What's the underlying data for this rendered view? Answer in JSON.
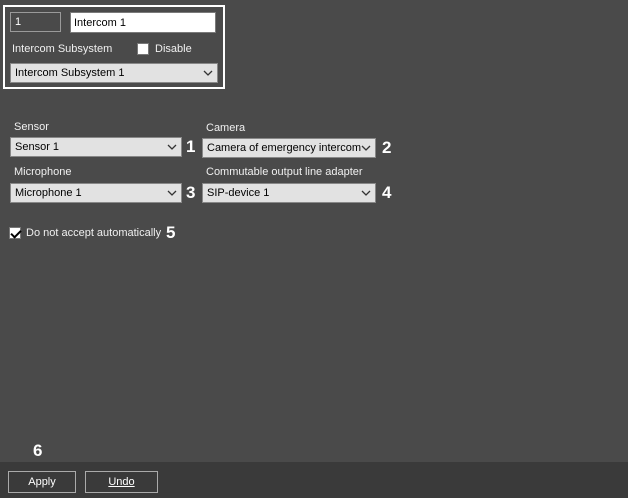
{
  "object": {
    "id_value": "1",
    "name_value": "Intercom 1",
    "subsystem_label": "Intercom Subsystem",
    "disable_label": "Disable",
    "disable_checked": false,
    "subsystem_selected": "Intercom Subsystem 1"
  },
  "settings": {
    "sensor_label": "Sensor",
    "sensor_selected": "Sensor 1",
    "camera_label": "Camera",
    "camera_selected": "Camera of emergency intercom",
    "microphone_label": "Microphone",
    "microphone_selected": "Microphone 1",
    "adapter_label": "Commutable output line adapter",
    "adapter_selected": "SIP-device 1",
    "accept_label": "Do not accept automatically",
    "accept_checked": true
  },
  "callouts": [
    "1",
    "2",
    "3",
    "4",
    "5",
    "6"
  ],
  "footer": {
    "apply_label": "Apply",
    "undo_label": "Undo"
  },
  "colors": {
    "panel_bg": "#4a4a4a",
    "footer_bg": "#3a3a3a",
    "select_bg": "#e2e2e2"
  }
}
